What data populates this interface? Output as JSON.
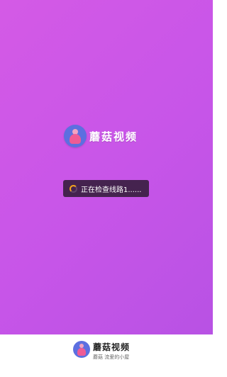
{
  "splash": {
    "app_name": "蘑菇视频",
    "loading_text": "正在检查线路1......",
    "icon": "app-logo-icon",
    "background_color": "#cf58e6"
  },
  "footer": {
    "app_name": "蘑菇视频",
    "tagline": "蘑菇 流爱的小屋",
    "icon": "app-logo-icon"
  },
  "colors": {
    "spinner": "#f4a51c",
    "toast_bg": "#28192d",
    "logo_bg": "#5d6fe0"
  }
}
